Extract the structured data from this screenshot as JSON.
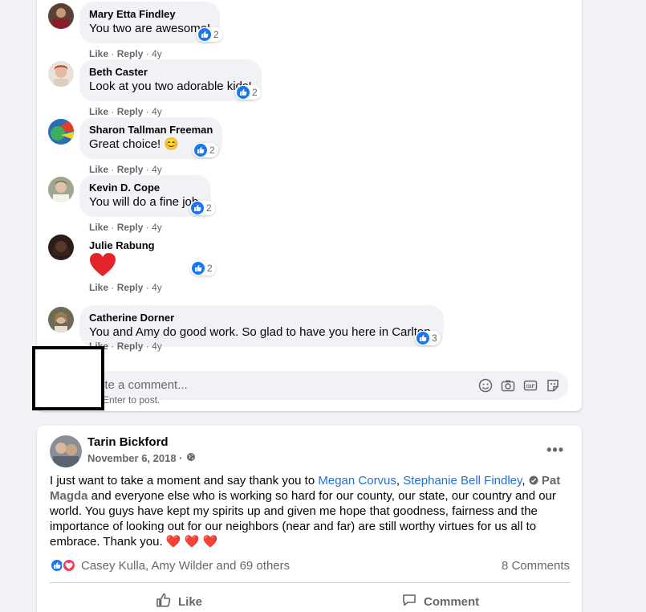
{
  "comments": [
    {
      "author": "Mary Etta Findley",
      "text": "You two are awesome!",
      "like": "Like",
      "reply": "Reply",
      "time": "4y",
      "reactions": "2"
    },
    {
      "author": "Beth Caster",
      "text": "Look at you two adorable kids!",
      "like": "Like",
      "reply": "Reply",
      "time": "4y",
      "reactions": "2"
    },
    {
      "author": "Sharon Tallman Freeman",
      "text": "Great choice! 😊",
      "like": "Like",
      "reply": "Reply",
      "time": "4y",
      "reactions": "2"
    },
    {
      "author": "Kevin D. Cope",
      "text": "You will do a fine job.",
      "like": "Like",
      "reply": "Reply",
      "time": "4y",
      "reactions": "2"
    },
    {
      "author": "Julie Rabung",
      "text": "",
      "like": "Like",
      "reply": "Reply",
      "time": "4y",
      "reactions": "2"
    },
    {
      "author": "Catherine Dorner",
      "text": "You and Amy do good work. So glad to have you here in Carlton.",
      "like": "Like",
      "reply": "Reply",
      "time": "4y",
      "reactions": "3"
    }
  ],
  "separator": "·",
  "comment_box": {
    "placeholder": "ite a comment...",
    "hint": "Enter to post."
  },
  "post": {
    "author": "Tarin Bickford",
    "date": "November 6, 2018 ·",
    "more": "•••",
    "body_intro": "I just want to take a moment and say thank you to ",
    "mention_1": "Megan Corvus",
    "sep_1": ", ",
    "mention_2": "Stephanie Bell Findley",
    "sep_2": ", ",
    "mention_3": "Pat Magda",
    "body_rest": " and everyone else who is working so hard for our county, our state, our country and our world. You guys have kept my spirits up and given me hope that goodness, fairness and the importance of looking out for our neighbors (near and far) are still worthy virtues for us all to embrace. Thank you. ",
    "hearts": "❤️ ❤️ ❤️",
    "reactors": "Casey Kulla, Amy Wilder and 69 others",
    "comments_count": "8 Comments",
    "like_label": "Like",
    "comment_label": "Comment"
  },
  "colors": {
    "accent": "#1877f2",
    "link": "#216fdb",
    "heart": "#f33e58"
  }
}
